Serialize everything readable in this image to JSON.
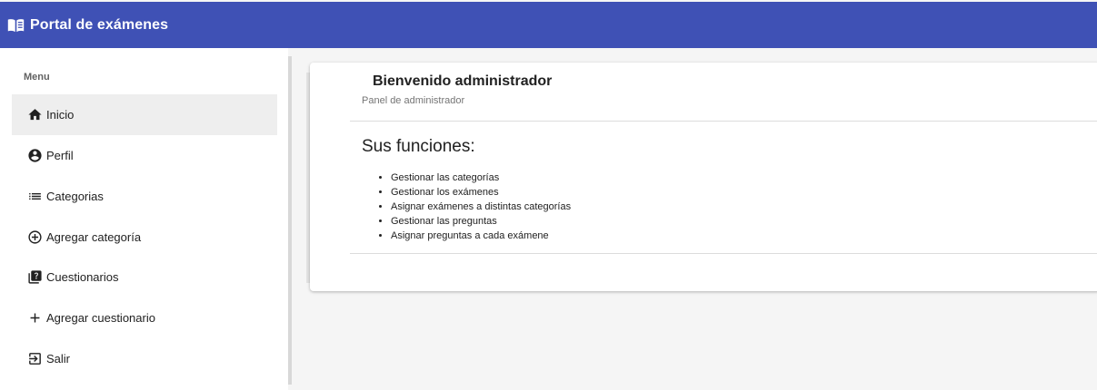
{
  "app": {
    "title": "Portal de exámenes",
    "brand_icon": "book-open-icon",
    "colors": {
      "topbar": "#3f51b5",
      "active_item_bg": "#eeeeee"
    }
  },
  "sidebar": {
    "menu_title": "Menu",
    "items": [
      {
        "label": "Inicio",
        "icon": "home-icon",
        "active": true
      },
      {
        "label": "Perfil",
        "icon": "account-circle-icon"
      },
      {
        "label": "Categorias",
        "icon": "list-icon"
      },
      {
        "label": "Agregar categoría",
        "icon": "add-circle-icon"
      },
      {
        "label": "Cuestionarios",
        "icon": "quiz-icon"
      },
      {
        "label": "Agregar cuestionario",
        "icon": "plus-icon"
      },
      {
        "label": "Salir",
        "icon": "logout-icon"
      }
    ]
  },
  "main": {
    "card": {
      "title": "Bienvenido administrador",
      "subtitle": "Panel de administrador",
      "section_title": "Sus funciones:",
      "functions": [
        "Gestionar las categorías",
        "Gestionar los exámenes",
        "Asignar exámenes a distintas categorías",
        "Gestionar las preguntas",
        "Asignar preguntas a cada exámene"
      ]
    }
  }
}
